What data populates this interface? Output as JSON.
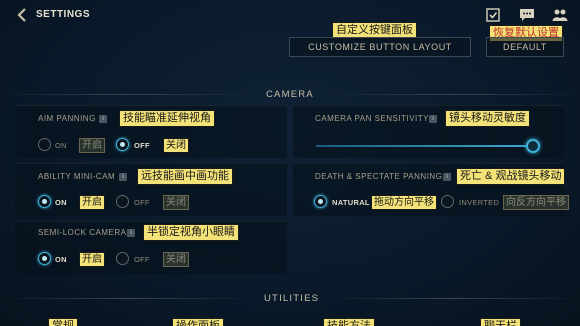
{
  "header": {
    "title": "SETTINGS",
    "icons": [
      "back-chevron-icon",
      "missions-icon",
      "chat-icon",
      "friends-icon"
    ]
  },
  "top_buttons": {
    "customize": "CUSTOMIZE BUTTON LAYOUT",
    "customize_cn": "自定义按键面板",
    "default": "DEFAULT",
    "default_cn": "恢复默认设置"
  },
  "camera": {
    "title": "CAMERA",
    "aim_panning": {
      "label": "AIM PANNING",
      "label_cn": "技能瞄准延伸视角",
      "on": "ON",
      "on_cn": "开启",
      "off": "OFF",
      "off_cn": "关闭",
      "selected": "off"
    },
    "pan_sensitivity": {
      "label": "CAMERA PAN SENSITIVITY",
      "label_cn": "镜头移动灵敏度",
      "value_fraction": 1.0
    },
    "ability_minicam": {
      "label": "ABILITY MINI-CAM",
      "label_cn": "远技能画中画功能",
      "on": "ON",
      "on_cn": "开启",
      "off": "OFF",
      "off_cn": "关闭",
      "selected": "on"
    },
    "death_panning": {
      "label": "DEATH & SPECTATE PANNING",
      "label_cn": "死亡 & 观战镜头移动",
      "natural": "NATURAL",
      "natural_cn": "拖动方向平移",
      "inverted": "INVERTED",
      "inverted_cn": "向反方向平移",
      "selected": "natural"
    },
    "semi_lock": {
      "label": "SEMI-LOCK CAMERA",
      "label_cn": "半锁定视角小眼睛",
      "on": "ON",
      "on_cn": "开启",
      "off": "OFF",
      "off_cn": "关闭",
      "selected": "on"
    }
  },
  "utilities": {
    "title": "UTILITIES",
    "bottom_tags": [
      "常规",
      "操作面板",
      "技能方法",
      "聊天栏"
    ]
  },
  "colors": {
    "accent": "#3fb0d8",
    "tag_bg": "#f3e277",
    "tag_red": "#c0302a"
  }
}
